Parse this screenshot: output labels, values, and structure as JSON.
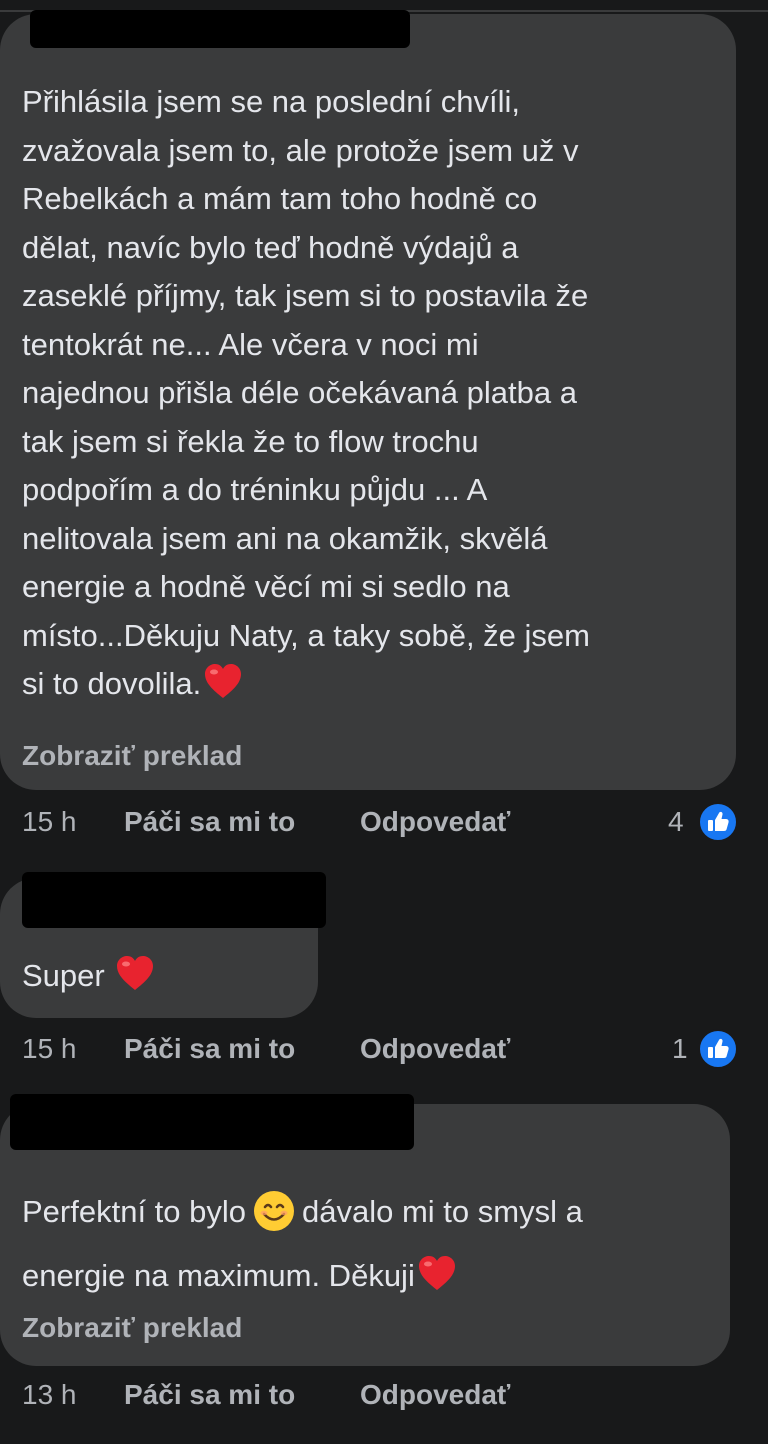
{
  "comments": [
    {
      "text": "Přihlásila jsem se na poslední chvíli,\nzvažovala jsem to, ale protože jsem už v\nRebelkách a mám tam toho hodně co\ndělat, navíc bylo teď hodně výdajů a\nzaseklé příjmy, tak jsem si to postavila že\ntentokrát ne... Ale včera v noci mi\nnajednou přišla déle očekávaná platba a\ntak jsem si řekla že to flow trochu\npodpořím a do tréninku půjdu ... A\nnelitovala jsem ani na okamžik, skvělá\nenergie a hodně věcí mi si sedlo na\nmísto...Děkuju Naty, a taky sobě, že jsem\nsi to dovolila.",
      "translate": "Zobraziť preklad",
      "time": "15 h",
      "like_label": "Páči sa mi to",
      "reply_label": "Odpovedať",
      "reactions": "4"
    },
    {
      "text": "Super",
      "time": "15 h",
      "like_label": "Páči sa mi to",
      "reply_label": "Odpovedať",
      "reactions": "1"
    },
    {
      "text_a": "Perfektní to bylo",
      "text_b": "dávalo mi to smysl a",
      "text_c": "energie na maximum. Děkuji",
      "translate": "Zobraziť preklad",
      "time": "13 h",
      "like_label": "Páči sa mi to",
      "reply_label": "Odpovedať"
    }
  ],
  "colors": {
    "background": "#18191a",
    "bubble": "#3a3b3c",
    "text": "#e4e6eb",
    "secondary": "#b0b3b8",
    "like_blue": "#1877f2",
    "heart_red": "#e8232f"
  },
  "icons": {
    "heart": "heart-icon",
    "like": "like-thumb-icon",
    "smile": "smile-emoji-icon"
  }
}
